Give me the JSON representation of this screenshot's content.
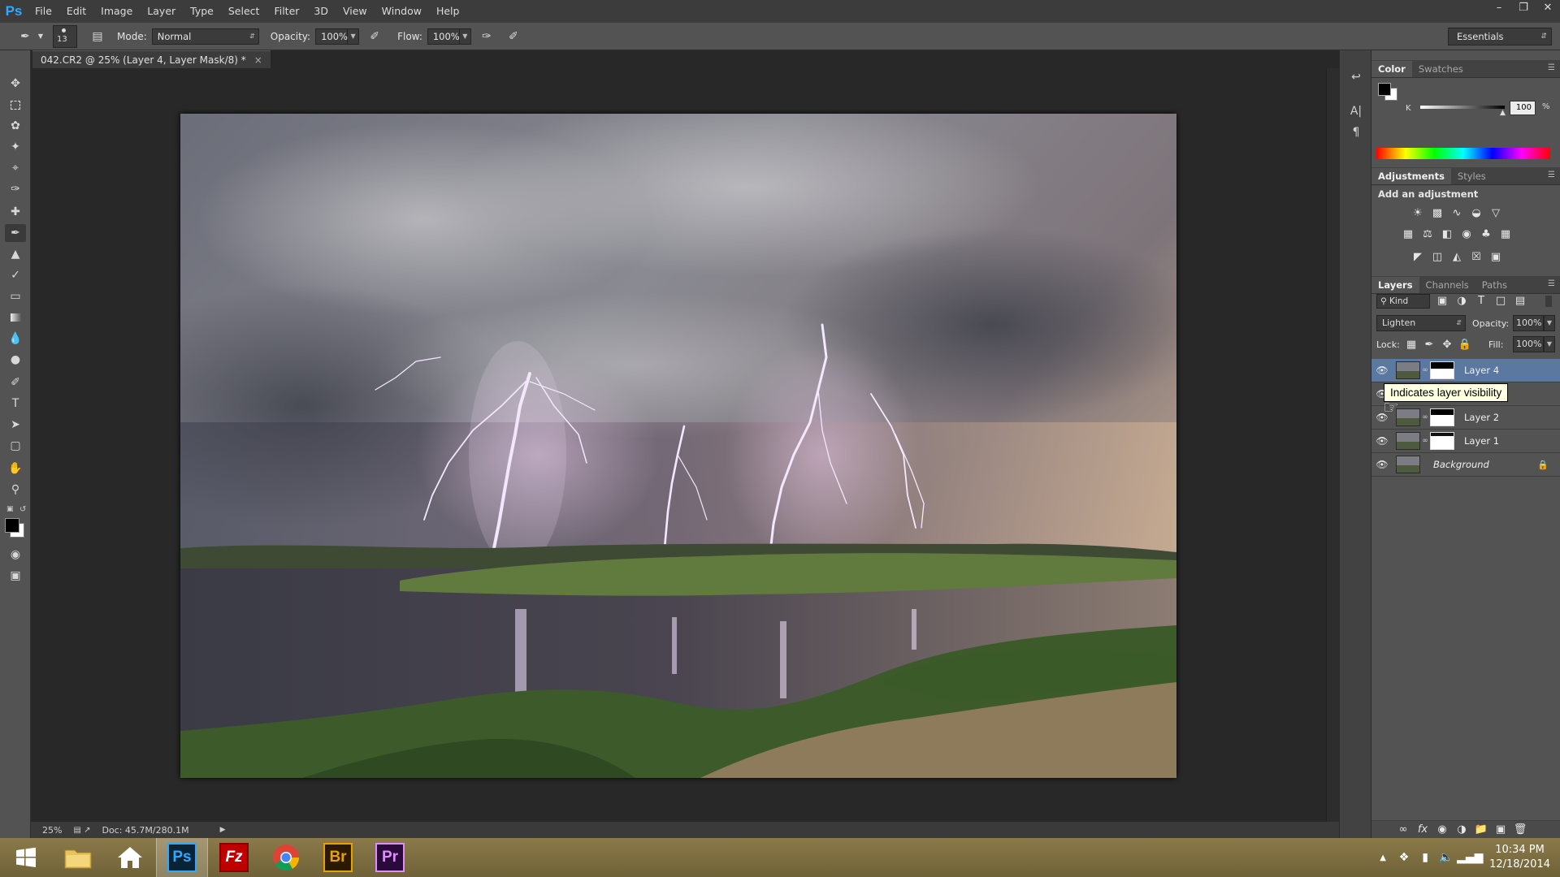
{
  "app": {
    "logo": "Ps"
  },
  "menu": [
    "File",
    "Edit",
    "Image",
    "Layer",
    "Type",
    "Select",
    "Filter",
    "3D",
    "View",
    "Window",
    "Help"
  ],
  "options_bar": {
    "brush_size": "13",
    "mode_label": "Mode:",
    "mode_value": "Normal",
    "opacity_label": "Opacity:",
    "opacity_value": "100%",
    "flow_label": "Flow:",
    "flow_value": "100%",
    "workspace": "Essentials"
  },
  "document": {
    "tab_title": "042.CR2 @ 25% (Layer 4, Layer Mask/8) *",
    "zoom": "25%",
    "doc_size": "Doc: 45.7M/280.1M"
  },
  "color_panel": {
    "tabs": [
      "Color",
      "Swatches"
    ],
    "channel_label": "K",
    "channel_value": "100",
    "channel_unit": "%"
  },
  "adjustments_panel": {
    "tabs": [
      "Adjustments",
      "Styles"
    ],
    "heading": "Add an adjustment"
  },
  "layers_panel": {
    "tabs": [
      "Layers",
      "Channels",
      "Paths"
    ],
    "filter_kind": "Kind",
    "blend_mode": "Lighten",
    "opacity_label": "Opacity:",
    "opacity_value": "100%",
    "lock_label": "Lock:",
    "fill_label": "Fill:",
    "fill_value": "100%",
    "layers": [
      {
        "name": "Layer 4",
        "selected": true
      },
      {
        "name": "",
        "selected": false
      },
      {
        "name": "Layer 2",
        "selected": false
      },
      {
        "name": "Layer 1",
        "selected": false
      },
      {
        "name": "Background",
        "selected": false
      }
    ]
  },
  "tooltip": "Indicates layer visibility",
  "taskbar": {
    "apps": [
      "Windows Explorer",
      "Home",
      "Ps",
      "Fz",
      "Chrome",
      "Br",
      "Pr"
    ],
    "time": "10:34 PM",
    "date": "12/18/2014"
  },
  "colors": {
    "ps_blue": "#31a8ff",
    "selected_layer": "#5a78a0",
    "bridge": "#e8a200",
    "premiere": "#e08cff",
    "filezilla": "#bf0000"
  }
}
